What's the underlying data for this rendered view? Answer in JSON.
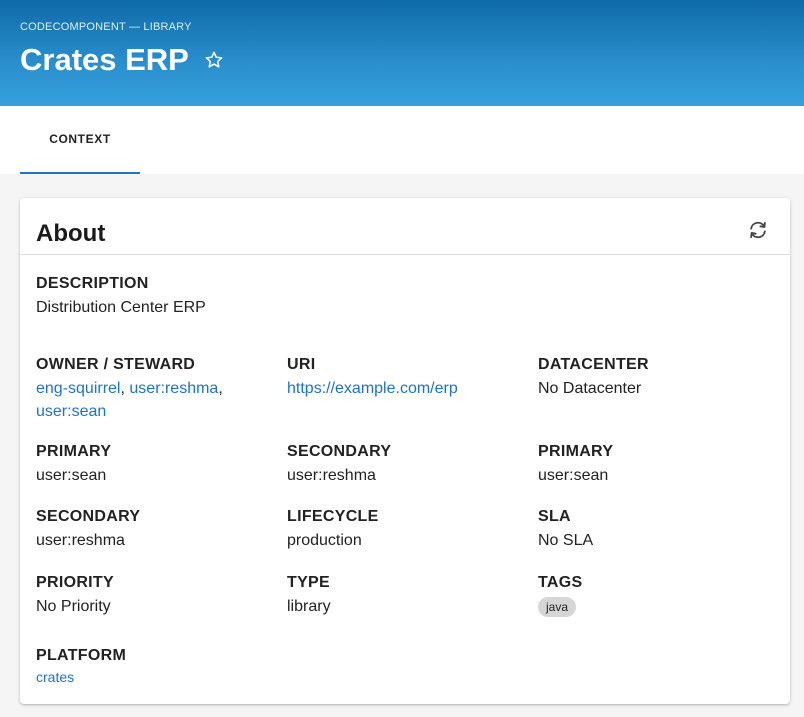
{
  "header": {
    "breadcrumb": "CODECOMPONENT — LIBRARY",
    "title": "Crates ERP",
    "star_icon": "star-outline-icon",
    "background_colors": [
      "#0f6aa8",
      "#35a0db"
    ]
  },
  "tabs": [
    {
      "label": "CONTEXT",
      "active": true
    }
  ],
  "about": {
    "title": "About",
    "refresh_icon": "refresh-icon",
    "description": {
      "label": "DESCRIPTION",
      "value": "Distribution Center ERP"
    },
    "owner": {
      "label": "OWNER / STEWARD",
      "items": [
        "eng-squirrel",
        "user:reshma",
        "user:sean"
      ],
      "separator": ","
    },
    "uri": {
      "label": "URI",
      "value": "https://example.com/erp"
    },
    "datacenter": {
      "label": "DATACENTER",
      "value": "No Datacenter"
    },
    "primary1": {
      "label": "PRIMARY",
      "value": "user:sean"
    },
    "secondary1": {
      "label": "SECONDARY",
      "value": "user:reshma"
    },
    "primary2": {
      "label": "PRIMARY",
      "value": "user:sean"
    },
    "secondary2": {
      "label": "SECONDARY",
      "value": "user:reshma"
    },
    "lifecycle": {
      "label": "LIFECYCLE",
      "value": "production"
    },
    "sla": {
      "label": "SLA",
      "value": "No SLA"
    },
    "priority": {
      "label": "PRIORITY",
      "value": "No Priority"
    },
    "type": {
      "label": "TYPE",
      "value": "library"
    },
    "tags": {
      "label": "TAGS",
      "items": [
        "java"
      ]
    },
    "platform": {
      "label": "PLATFORM",
      "value": "crates"
    }
  },
  "colors": {
    "link": "#1f73c4",
    "tab_indicator": "#1f73c4",
    "chip_bg": "#d6d6d6"
  }
}
